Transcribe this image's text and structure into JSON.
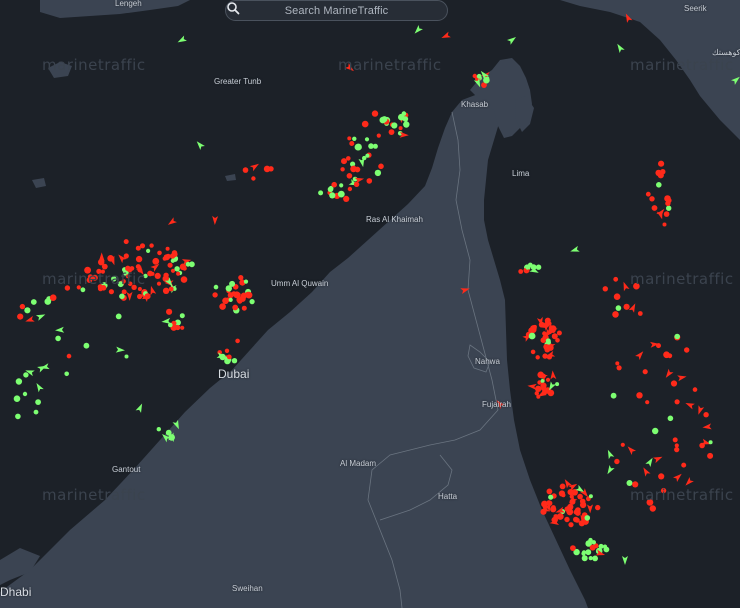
{
  "search": {
    "placeholder": "Search MarineTraffic"
  },
  "icons": {
    "search": "search-icon",
    "vessel_moving": "arrow-icon",
    "vessel_stopped": "circle-icon"
  },
  "colors": {
    "land": "#3b4452",
    "sea": "#1c2128",
    "vessel_red": "#ff2a1a",
    "vessel_green": "#7dff72"
  },
  "watermark": "marinetraffic",
  "places": {
    "greater_tunb": "Greater Tunb",
    "khasab": "Khasab",
    "lima": "Lima",
    "ras_al_khaimah": "Ras Al Khaimah",
    "umm_al_quwain": "Umm Al Quwain",
    "dubai": "Dubai",
    "nahwa": "Nahwa",
    "fujairah": "Fujairah",
    "al_madam": "Al Madam",
    "hatta": "Hatta",
    "gantout": "Gantout",
    "sweihan": "Sweihan",
    "dhabi": "Dhabi",
    "top_left_town": "Lengeh",
    "seerik": "Seerik",
    "arabic": "كوهستك"
  }
}
